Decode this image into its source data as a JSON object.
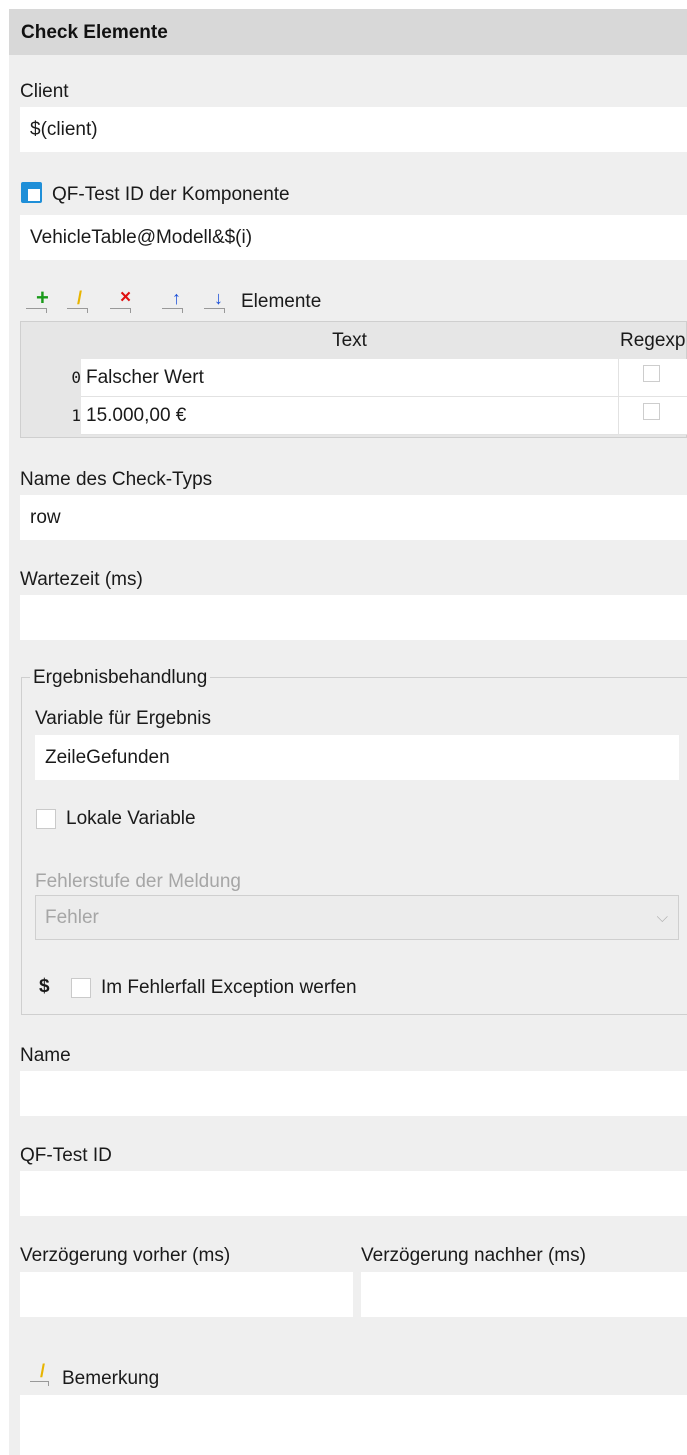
{
  "header": {
    "title": "Check Elemente"
  },
  "client": {
    "label": "Client",
    "value": "$(client)"
  },
  "component": {
    "label": "QF-Test ID der Komponente",
    "value": "VehicleTable@Modell&$(i)",
    "icon": "component-icon"
  },
  "elements": {
    "label": "Elemente",
    "toolbar": [
      {
        "name": "add-row-button",
        "icon": "plus-icon",
        "color": "#1a9a1a"
      },
      {
        "name": "edit-row-button",
        "icon": "pencil-icon",
        "color": "#e8b400"
      },
      {
        "name": "delete-row-button",
        "icon": "delete-icon",
        "color": "#e01010"
      },
      {
        "name": "move-up-button",
        "icon": "arrow-up-icon",
        "color": "#1a4fd8"
      },
      {
        "name": "move-down-button",
        "icon": "arrow-down-icon",
        "color": "#1a4fd8"
      }
    ],
    "columns": {
      "text": "Text",
      "regexp": "Regexp"
    },
    "rows": [
      {
        "index": "0",
        "text": "Falscher Wert",
        "regexp": false
      },
      {
        "index": "1",
        "text": "15.000,00 €",
        "regexp": false
      }
    ]
  },
  "check_type": {
    "label": "Name des Check-Typs",
    "value": "row"
  },
  "wait_time": {
    "label": "Wartezeit (ms)",
    "value": ""
  },
  "result_handling": {
    "title": "Ergebnisbehandlung",
    "variable_label": "Variable für Ergebnis",
    "variable_value": "ZeileGefunden",
    "local_variable_label": "Lokale Variable",
    "error_level_label": "Fehlerstufe der Meldung",
    "error_level_value": "Fehler",
    "exception_symbol": "$",
    "exception_label": "Im Fehlerfall Exception werfen"
  },
  "name": {
    "label": "Name",
    "value": ""
  },
  "qftest_id": {
    "label": "QF-Test ID",
    "value": ""
  },
  "delay_before": {
    "label": "Verzögerung vorher (ms)",
    "value": ""
  },
  "delay_after": {
    "label": "Verzögerung nachher (ms)",
    "value": ""
  },
  "comment": {
    "label": "Bemerkung",
    "value": ""
  }
}
